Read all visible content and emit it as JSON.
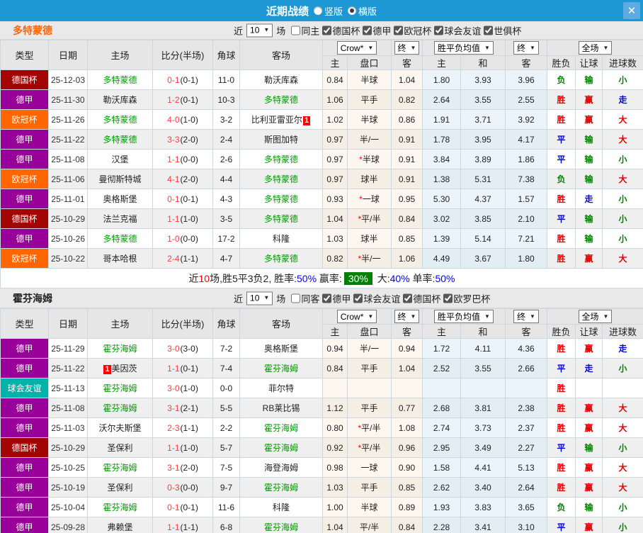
{
  "titlebar": {
    "title": "近期战绩",
    "mode_vertical": "竖版",
    "mode_horizontal": "横版",
    "selected_mode": "横版"
  },
  "icons": {
    "close": "✕",
    "dropdown_arrow": "▼"
  },
  "table_headers": {
    "main": [
      "类型",
      "日期",
      "主场",
      "比分(半场)",
      "角球",
      "客场"
    ],
    "sub": [
      "主",
      "盘口",
      "客",
      "主",
      "和",
      "客",
      "胜负",
      "让球",
      "进球数"
    ],
    "dropdowns": [
      "Crow*",
      "终",
      "胜平负均值",
      "终",
      "全场"
    ]
  },
  "league_colors": {
    "德国杯": "#a30505",
    "德甲": "#990099",
    "欧冠杯": "#ff6600",
    "球会友谊": "#00b2a9"
  },
  "result_colors": {
    "胜": "red",
    "平": "blue",
    "负": "green",
    "赢": "red",
    "走": "blue",
    "输": "green",
    "大": "red",
    "小": "green"
  },
  "sections": [
    {
      "team": "多特蒙德",
      "team_color": "#ff6600",
      "filter": {
        "near": "近",
        "count": "10",
        "matches": "场",
        "same": "同主",
        "same_checked": false,
        "leagues": [
          {
            "label": "德国杯",
            "checked": true
          },
          {
            "label": "德甲",
            "checked": true
          },
          {
            "label": "欧冠杯",
            "checked": true
          },
          {
            "label": "球会友谊",
            "checked": true
          },
          {
            "label": "世俱杯",
            "checked": true
          }
        ]
      },
      "rows": [
        {
          "league": "德国杯",
          "date": "25-12-03",
          "home": {
            "name": "多特蒙德",
            "self": true
          },
          "score": "0-1",
          "half": "(0-1)",
          "corner": "11-0",
          "away": {
            "name": "勒沃库森",
            "self": false
          },
          "crow_home": "0.84",
          "handicap": "半球",
          "crow_away": "1.04",
          "avg_home": "1.80",
          "avg_draw": "3.93",
          "avg_away": "3.96",
          "wdl": "负",
          "let": "输",
          "goals": "小"
        },
        {
          "league": "德甲",
          "date": "25-11-30",
          "home": {
            "name": "勒沃库森",
            "self": false
          },
          "score": "1-2",
          "half": "(0-1)",
          "corner": "10-3",
          "away": {
            "name": "多特蒙德",
            "self": true
          },
          "crow_home": "1.06",
          "handicap": "平手",
          "crow_away": "0.82",
          "avg_home": "2.64",
          "avg_draw": "3.55",
          "avg_away": "2.55",
          "wdl": "胜",
          "let": "赢",
          "goals": "走"
        },
        {
          "league": "欧冠杯",
          "date": "25-11-26",
          "home": {
            "name": "多特蒙德",
            "self": true
          },
          "score": "4-0",
          "half": "(1-0)",
          "corner": "3-2",
          "away": {
            "name": "比利亚雷亚尔",
            "self": false,
            "badge": "1",
            "badge_pos": "after"
          },
          "crow_home": "1.02",
          "handicap": "半球",
          "crow_away": "0.86",
          "avg_home": "1.91",
          "avg_draw": "3.71",
          "avg_away": "3.92",
          "wdl": "胜",
          "let": "赢",
          "goals": "大"
        },
        {
          "league": "德甲",
          "date": "25-11-22",
          "home": {
            "name": "多特蒙德",
            "self": true
          },
          "score": "3-3",
          "half": "(2-0)",
          "corner": "2-4",
          "away": {
            "name": "斯图加特",
            "self": false
          },
          "crow_home": "0.97",
          "handicap": "半/一",
          "crow_away": "0.91",
          "avg_home": "1.78",
          "avg_draw": "3.95",
          "avg_away": "4.17",
          "wdl": "平",
          "let": "输",
          "goals": "大"
        },
        {
          "league": "德甲",
          "date": "25-11-08",
          "home": {
            "name": "汉堡",
            "self": false
          },
          "score": "1-1",
          "half": "(0-0)",
          "corner": "2-6",
          "away": {
            "name": "多特蒙德",
            "self": true
          },
          "crow_home": "0.97",
          "handicap": "*半球",
          "crow_away": "0.91",
          "avg_home": "3.84",
          "avg_draw": "3.89",
          "avg_away": "1.86",
          "wdl": "平",
          "let": "输",
          "goals": "小"
        },
        {
          "league": "欧冠杯",
          "date": "25-11-06",
          "home": {
            "name": "曼彻斯特城",
            "self": false
          },
          "score": "4-1",
          "half": "(2-0)",
          "corner": "4-4",
          "away": {
            "name": "多特蒙德",
            "self": true
          },
          "crow_home": "0.97",
          "handicap": "球半",
          "crow_away": "0.91",
          "avg_home": "1.38",
          "avg_draw": "5.31",
          "avg_away": "7.38",
          "wdl": "负",
          "let": "输",
          "goals": "大"
        },
        {
          "league": "德甲",
          "date": "25-11-01",
          "home": {
            "name": "奥格斯堡",
            "self": false
          },
          "score": "0-1",
          "half": "(0-1)",
          "corner": "4-3",
          "away": {
            "name": "多特蒙德",
            "self": true
          },
          "crow_home": "0.93",
          "handicap": "*一球",
          "crow_away": "0.95",
          "avg_home": "5.30",
          "avg_draw": "4.37",
          "avg_away": "1.57",
          "wdl": "胜",
          "let": "走",
          "goals": "小"
        },
        {
          "league": "德国杯",
          "date": "25-10-29",
          "home": {
            "name": "法兰克福",
            "self": false
          },
          "score": "1-1",
          "half": "(1-0)",
          "corner": "3-5",
          "away": {
            "name": "多特蒙德",
            "self": true
          },
          "crow_home": "1.04",
          "handicap": "*平/半",
          "crow_away": "0.84",
          "avg_home": "3.02",
          "avg_draw": "3.85",
          "avg_away": "2.10",
          "wdl": "平",
          "let": "输",
          "goals": "小"
        },
        {
          "league": "德甲",
          "date": "25-10-26",
          "home": {
            "name": "多特蒙德",
            "self": true
          },
          "score": "1-0",
          "half": "(0-0)",
          "corner": "17-2",
          "away": {
            "name": "科隆",
            "self": false
          },
          "crow_home": "1.03",
          "handicap": "球半",
          "crow_away": "0.85",
          "avg_home": "1.39",
          "avg_draw": "5.14",
          "avg_away": "7.21",
          "wdl": "胜",
          "let": "输",
          "goals": "小"
        },
        {
          "league": "欧冠杯",
          "date": "25-10-22",
          "home": {
            "name": "哥本哈根",
            "self": false
          },
          "score": "2-4",
          "half": "(1-1)",
          "corner": "4-7",
          "away": {
            "name": "多特蒙德",
            "self": true
          },
          "crow_home": "0.82",
          "handicap": "*半/一",
          "crow_away": "1.06",
          "avg_home": "4.49",
          "avg_draw": "3.67",
          "avg_away": "1.80",
          "wdl": "胜",
          "let": "赢",
          "goals": "大"
        }
      ],
      "summary": [
        {
          "t": "近"
        },
        {
          "t": "10",
          "c": "red"
        },
        {
          "t": "场,胜5平3负2, 胜率:"
        },
        {
          "t": "50%",
          "c": "blue"
        },
        {
          "t": " 赢率:"
        },
        {
          "t": "30%",
          "c": "badge"
        },
        {
          "t": " 大:"
        },
        {
          "t": "40%",
          "c": "blue"
        },
        {
          "t": " 单率:"
        },
        {
          "t": "50%",
          "c": "blue"
        }
      ]
    },
    {
      "team": "霍芬海姆",
      "team_color": "#222222",
      "filter": {
        "near": "近",
        "count": "10",
        "matches": "场",
        "same": "同客",
        "same_checked": false,
        "leagues": [
          {
            "label": "德甲",
            "checked": true
          },
          {
            "label": "球会友谊",
            "checked": true
          },
          {
            "label": "德国杯",
            "checked": true
          },
          {
            "label": "欧罗巴杯",
            "checked": true
          }
        ]
      },
      "rows": [
        {
          "league": "德甲",
          "date": "25-11-29",
          "home": {
            "name": "霍芬海姆",
            "self": true
          },
          "score": "3-0",
          "half": "(3-0)",
          "corner": "7-2",
          "away": {
            "name": "奥格斯堡",
            "self": false
          },
          "crow_home": "0.94",
          "handicap": "半/一",
          "crow_away": "0.94",
          "avg_home": "1.72",
          "avg_draw": "4.11",
          "avg_away": "4.36",
          "wdl": "胜",
          "let": "赢",
          "goals": "走"
        },
        {
          "league": "德甲",
          "date": "25-11-22",
          "home": {
            "name": "美因茨",
            "self": false,
            "badge": "1",
            "badge_pos": "before"
          },
          "score": "1-1",
          "half": "(0-1)",
          "corner": "7-4",
          "away": {
            "name": "霍芬海姆",
            "self": true
          },
          "crow_home": "0.84",
          "handicap": "平手",
          "crow_away": "1.04",
          "avg_home": "2.52",
          "avg_draw": "3.55",
          "avg_away": "2.66",
          "wdl": "平",
          "let": "走",
          "goals": "小"
        },
        {
          "league": "球会友谊",
          "date": "25-11-13",
          "home": {
            "name": "霍芬海姆",
            "self": true
          },
          "score": "3-0",
          "half": "(1-0)",
          "corner": "0-0",
          "away": {
            "name": "菲尔特",
            "self": false
          },
          "crow_home": "",
          "handicap": "",
          "crow_away": "",
          "avg_home": "",
          "avg_draw": "",
          "avg_away": "",
          "wdl": "胜",
          "let": "",
          "goals": ""
        },
        {
          "league": "德甲",
          "date": "25-11-08",
          "home": {
            "name": "霍芬海姆",
            "self": true
          },
          "score": "3-1",
          "half": "(2-1)",
          "corner": "5-5",
          "away": {
            "name": "RB莱比锡",
            "self": false
          },
          "crow_home": "1.12",
          "handicap": "平手",
          "crow_away": "0.77",
          "avg_home": "2.68",
          "avg_draw": "3.81",
          "avg_away": "2.38",
          "wdl": "胜",
          "let": "赢",
          "goals": "大"
        },
        {
          "league": "德甲",
          "date": "25-11-03",
          "home": {
            "name": "沃尔夫斯堡",
            "self": false
          },
          "score": "2-3",
          "half": "(1-1)",
          "corner": "2-2",
          "away": {
            "name": "霍芬海姆",
            "self": true
          },
          "crow_home": "0.80",
          "handicap": "*平/半",
          "crow_away": "1.08",
          "avg_home": "2.74",
          "avg_draw": "3.73",
          "avg_away": "2.37",
          "wdl": "胜",
          "let": "赢",
          "goals": "大"
        },
        {
          "league": "德国杯",
          "date": "25-10-29",
          "home": {
            "name": "圣保利",
            "self": false
          },
          "score": "1-1",
          "half": "(1-0)",
          "corner": "5-7",
          "away": {
            "name": "霍芬海姆",
            "self": true
          },
          "crow_home": "0.92",
          "handicap": "*平/半",
          "crow_away": "0.96",
          "avg_home": "2.95",
          "avg_draw": "3.49",
          "avg_away": "2.27",
          "wdl": "平",
          "let": "输",
          "goals": "小"
        },
        {
          "league": "德甲",
          "date": "25-10-25",
          "home": {
            "name": "霍芬海姆",
            "self": true
          },
          "score": "3-1",
          "half": "(2-0)",
          "corner": "7-5",
          "away": {
            "name": "海登海姆",
            "self": false
          },
          "crow_home": "0.98",
          "handicap": "一球",
          "crow_away": "0.90",
          "avg_home": "1.58",
          "avg_draw": "4.41",
          "avg_away": "5.13",
          "wdl": "胜",
          "let": "赢",
          "goals": "大"
        },
        {
          "league": "德甲",
          "date": "25-10-19",
          "home": {
            "name": "圣保利",
            "self": false
          },
          "score": "0-3",
          "half": "(0-0)",
          "corner": "9-7",
          "away": {
            "name": "霍芬海姆",
            "self": true
          },
          "crow_home": "1.03",
          "handicap": "平手",
          "crow_away": "0.85",
          "avg_home": "2.62",
          "avg_draw": "3.40",
          "avg_away": "2.64",
          "wdl": "胜",
          "let": "赢",
          "goals": "大"
        },
        {
          "league": "德甲",
          "date": "25-10-04",
          "home": {
            "name": "霍芬海姆",
            "self": true
          },
          "score": "0-1",
          "half": "(0-1)",
          "corner": "11-6",
          "away": {
            "name": "科隆",
            "self": false
          },
          "crow_home": "1.00",
          "handicap": "半球",
          "crow_away": "0.89",
          "avg_home": "1.93",
          "avg_draw": "3.83",
          "avg_away": "3.65",
          "wdl": "负",
          "let": "输",
          "goals": "小"
        },
        {
          "league": "德甲",
          "date": "25-09-28",
          "home": {
            "name": "弗赖堡",
            "self": false
          },
          "score": "1-1",
          "half": "(1-1)",
          "corner": "6-8",
          "away": {
            "name": "霍芬海姆",
            "self": true
          },
          "crow_home": "1.04",
          "handicap": "平/半",
          "crow_away": "0.84",
          "avg_home": "2.28",
          "avg_draw": "3.41",
          "avg_away": "3.10",
          "wdl": "平",
          "let": "赢",
          "goals": "小"
        }
      ],
      "summary": null
    }
  ]
}
